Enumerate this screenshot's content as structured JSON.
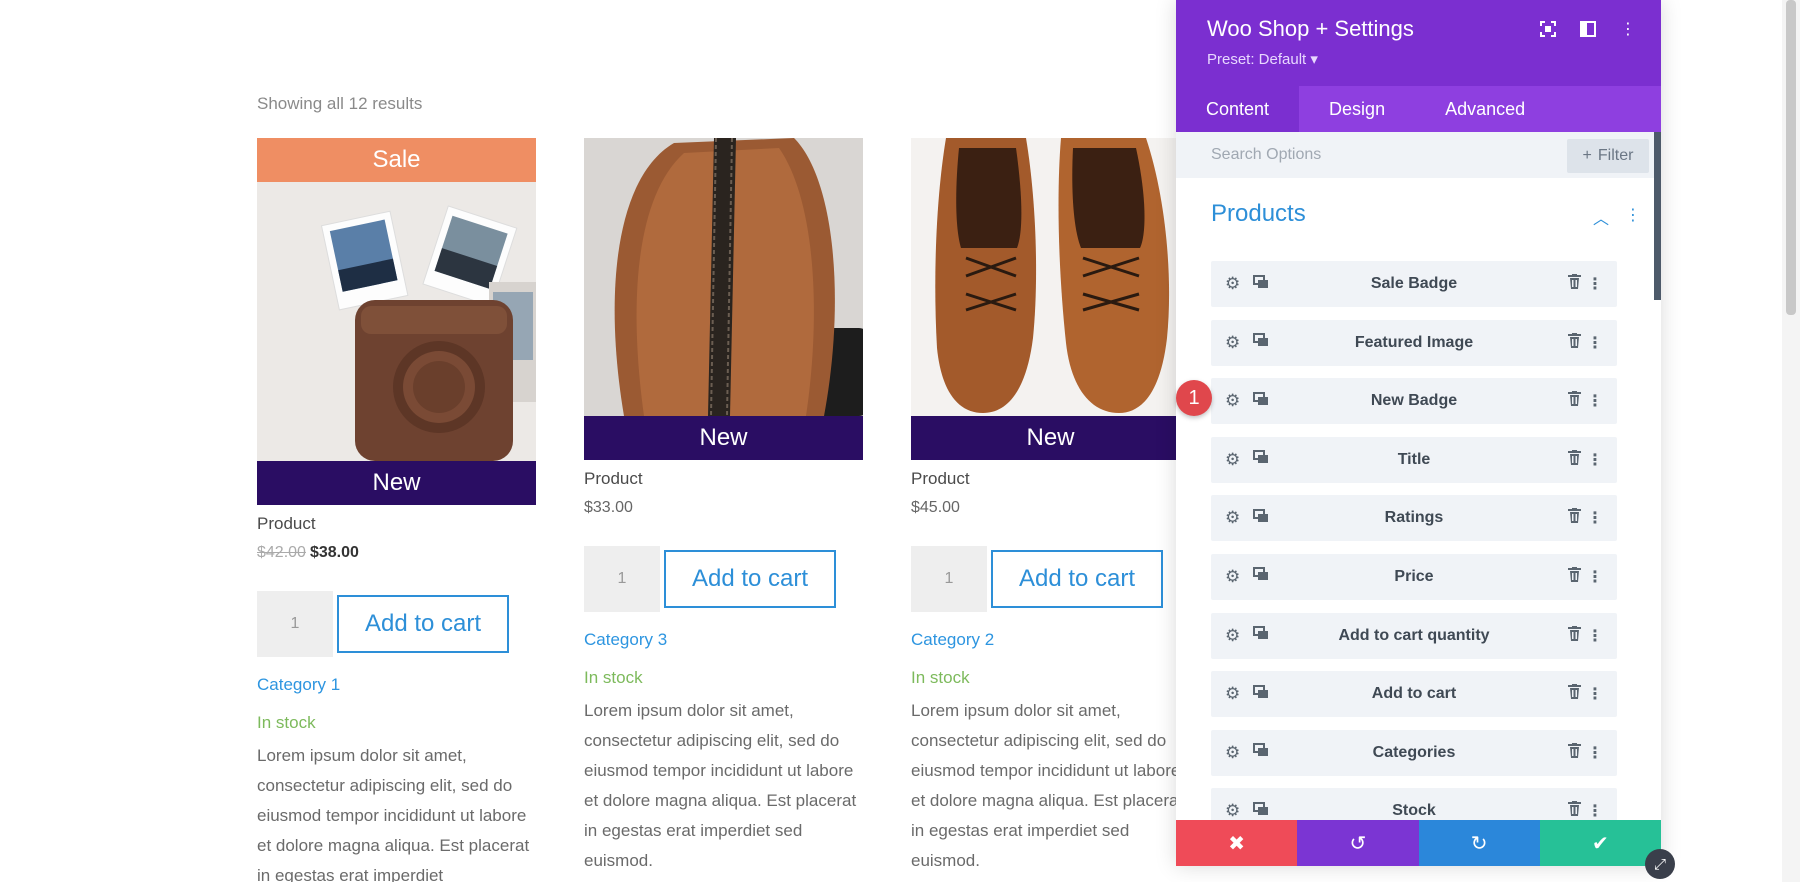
{
  "results_text": "Showing all 12 results",
  "products": [
    {
      "sale_badge": "Sale",
      "new_badge": "New",
      "title": "Product",
      "old_price": "$42.00",
      "price": "$38.00",
      "qty": "1",
      "add_to_cart": "Add to cart",
      "category": "Category 1",
      "stock": "In stock",
      "description": "Lorem ipsum dolor sit amet, consectetur adipiscing elit, sed do eiusmod tempor incididunt ut labore et dolore magna aliqua. Est placerat in egestas erat imperdiet"
    },
    {
      "new_badge": "New",
      "title": "Product",
      "price": "$33.00",
      "qty": "1",
      "add_to_cart": "Add to cart",
      "category": "Category 3",
      "stock": "In stock",
      "description": "Lorem ipsum dolor sit amet, consectetur adipiscing elit, sed do eiusmod tempor incididunt ut labore et dolore magna aliqua. Est placerat in egestas erat imperdiet sed euismod."
    },
    {
      "new_badge": "New",
      "title": "Product",
      "price": "$45.00",
      "qty": "1",
      "add_to_cart": "Add to cart",
      "category": "Category 2",
      "stock": "In stock",
      "description": "Lorem ipsum dolor sit amet, consectetur adipiscing elit, sed do eiusmod tempor incididunt ut labore et dolore magna aliqua. Est placerat in egestas erat imperdiet sed euismod."
    }
  ],
  "panel": {
    "title": "Woo Shop + Settings",
    "preset": "Preset: Default ▾",
    "tabs": [
      "Content",
      "Design",
      "Advanced"
    ],
    "search_placeholder": "Search Options",
    "filter_label": "Filter",
    "section_title": "Products",
    "items": [
      "Sale Badge",
      "Featured Image",
      "New Badge",
      "Title",
      "Ratings",
      "Price",
      "Add to cart quantity",
      "Add to cart",
      "Categories",
      "Stock"
    ],
    "marker": "1"
  },
  "colors": {
    "accent": "#7b2fd0",
    "tab_bar": "#8e3fe0",
    "link": "#2d8fd8",
    "sale": "#ef8e63",
    "new_badge": "#2a0d63",
    "stock": "#7dba5c",
    "cancel": "#ef4b58",
    "redo": "#2b87da",
    "save": "#26c197"
  }
}
